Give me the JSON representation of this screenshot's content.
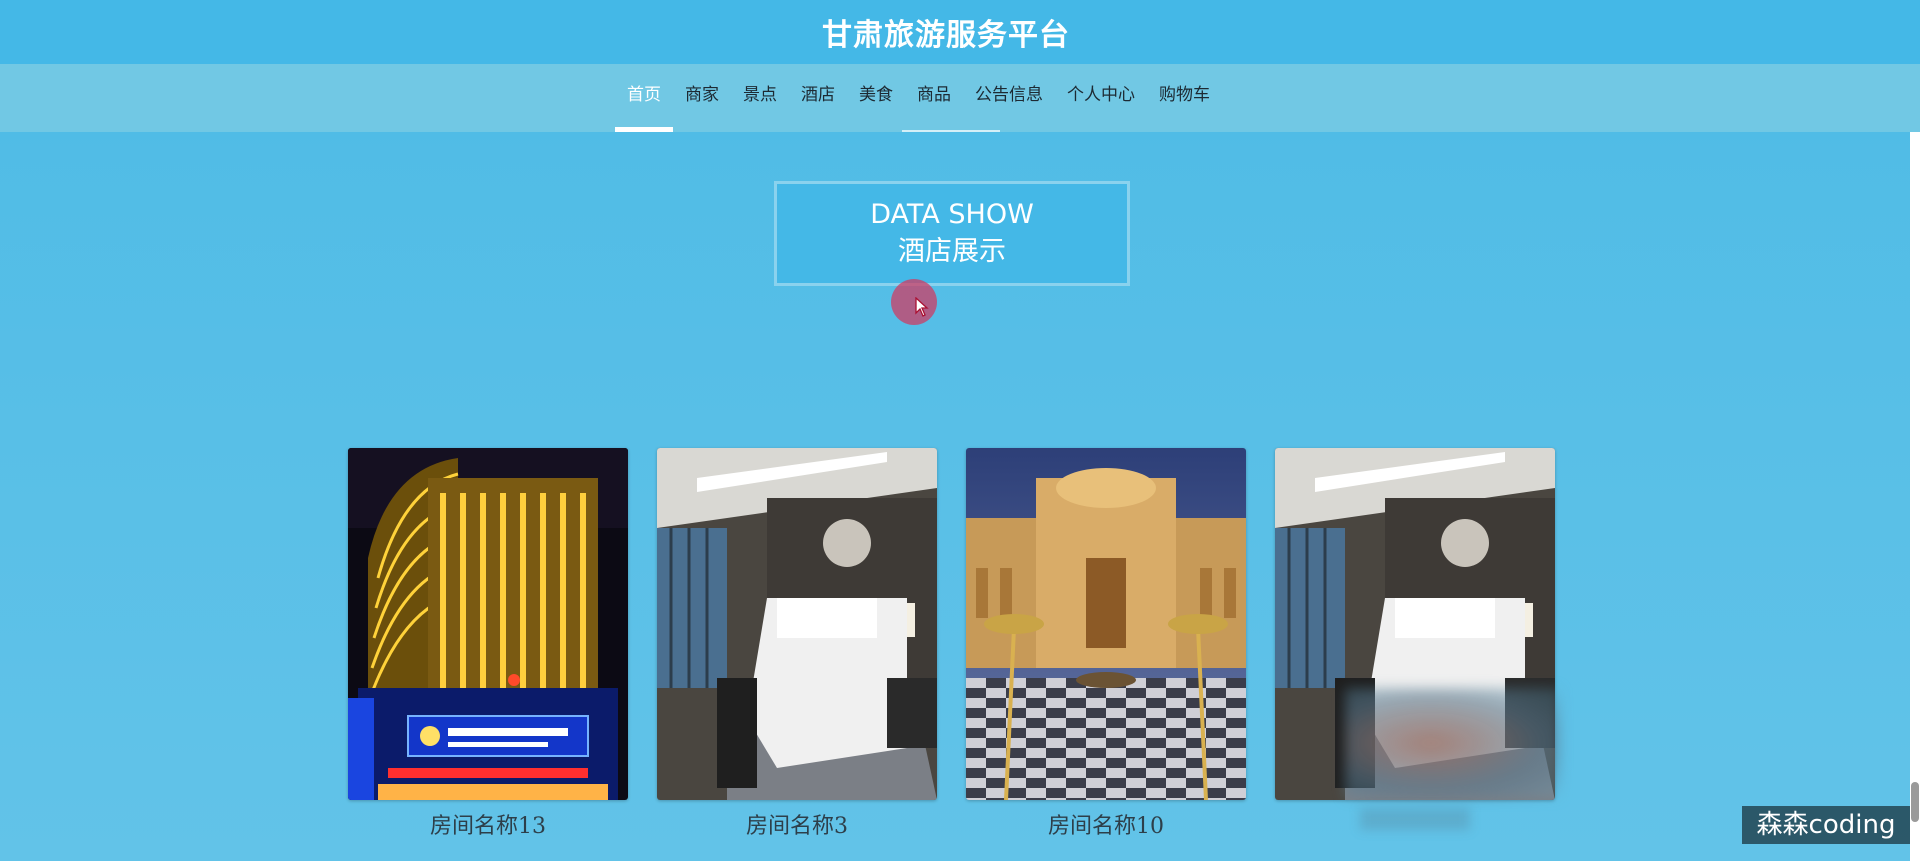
{
  "header": {
    "title": "甘肃旅游服务平台"
  },
  "nav": {
    "items": [
      {
        "label": "首页",
        "active": true
      },
      {
        "label": "商家"
      },
      {
        "label": "景点"
      },
      {
        "label": "酒店"
      },
      {
        "label": "美食"
      },
      {
        "label": "商品"
      },
      {
        "label": "公告信息"
      },
      {
        "label": "个人中心"
      },
      {
        "label": "购物车"
      }
    ]
  },
  "section": {
    "title_en": "DATA SHOW",
    "title_cn": "酒店展示"
  },
  "hotels": [
    {
      "name": "房间名称13",
      "image": "hotel-night-facade"
    },
    {
      "name": "房间名称3",
      "image": "hotel-room-bed"
    },
    {
      "name": "房间名称10",
      "image": "palace-courtyard"
    },
    {
      "name": "",
      "image": "hotel-room-bed"
    }
  ],
  "watermark": "森森coding",
  "colors": {
    "header_bg": "#44b8e7",
    "nav_bg": "#71c8e4",
    "page_bg": "#58bfe7",
    "accent": "#ffffff"
  }
}
